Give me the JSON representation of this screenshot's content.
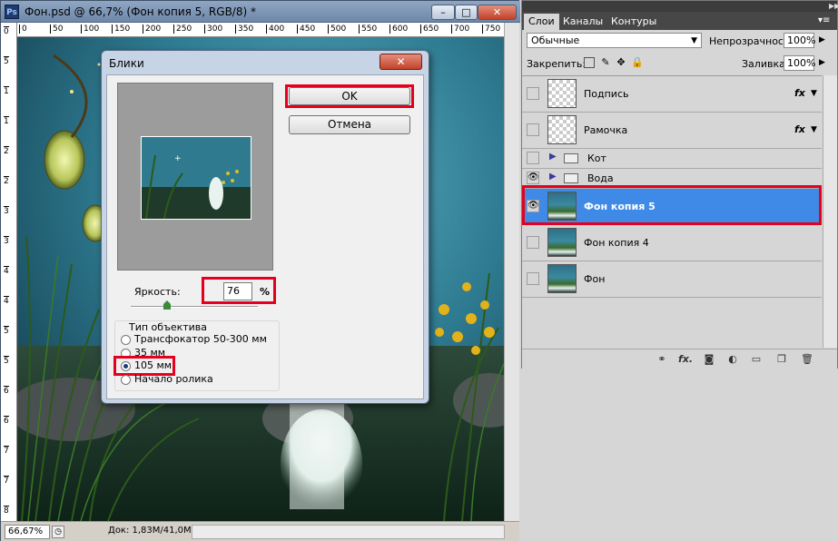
{
  "document": {
    "title": "Фон.psd @ 66,7% (Фон копия 5, RGB/8) *",
    "app_icon": "Ps",
    "window_buttons": [
      "–",
      "□",
      "✕"
    ],
    "ruler_top_labels": [
      "0",
      "50",
      "100",
      "150",
      "200",
      "250",
      "300",
      "350",
      "400",
      "450",
      "500",
      "550",
      "600",
      "650",
      "700",
      "750"
    ],
    "ruler_left_labels": [
      "0",
      "5",
      "1",
      "1",
      "2",
      "2",
      "3",
      "3",
      "4",
      "4",
      "5",
      "5",
      "6",
      "6",
      "7",
      "7",
      "8"
    ],
    "zoom": "66,67%",
    "doc_info": "Док: 1,83М/41,0М"
  },
  "dialog": {
    "title": "Блики",
    "ok_label": "OK",
    "cancel_label": "Отмена",
    "brightness_label": "Яркость:",
    "brightness_value": "76",
    "brightness_unit": "%",
    "brightness_level": 76,
    "lens_group_title": "Тип объектива",
    "lens_options": [
      "Трансфокатор 50-300 мм",
      "35 мм",
      "105 мм",
      "Начало ролика"
    ],
    "selected_lens": "105 мм"
  },
  "layers_panel": {
    "tabs": [
      "Слои",
      "Каналы",
      "Контуры"
    ],
    "blend_mode": "Обычные",
    "opacity_label": "Непрозрачность:",
    "opacity_value": "100%",
    "lock_label": "Закрепить:",
    "fill_label": "Заливка:",
    "fill_value": "100%",
    "layers": [
      {
        "name": "Подпись",
        "type": "layer",
        "thumb": "transparent",
        "fx": "fx",
        "visible": false
      },
      {
        "name": "Рамочка",
        "type": "layer",
        "thumb": "transparent",
        "fx": "fx",
        "visible": false
      },
      {
        "name": "Кот",
        "type": "group",
        "visible": false
      },
      {
        "name": "Вода",
        "type": "group",
        "visible": true
      },
      {
        "name": "Фон копия 5",
        "type": "layer",
        "thumb": "image",
        "visible": true,
        "selected": true
      },
      {
        "name": "Фон копия 4",
        "type": "layer",
        "thumb": "image",
        "visible": false
      },
      {
        "name": "Фон",
        "type": "layer",
        "thumb": "image",
        "visible": false
      }
    ],
    "bottom_icons": [
      "link-icon",
      "fx-icon",
      "mask-icon",
      "adjustment-icon",
      "group-icon",
      "new-layer-icon",
      "trash-icon"
    ]
  },
  "highlight_color": "#e5001e",
  "selection_color": "#3f8ae6"
}
